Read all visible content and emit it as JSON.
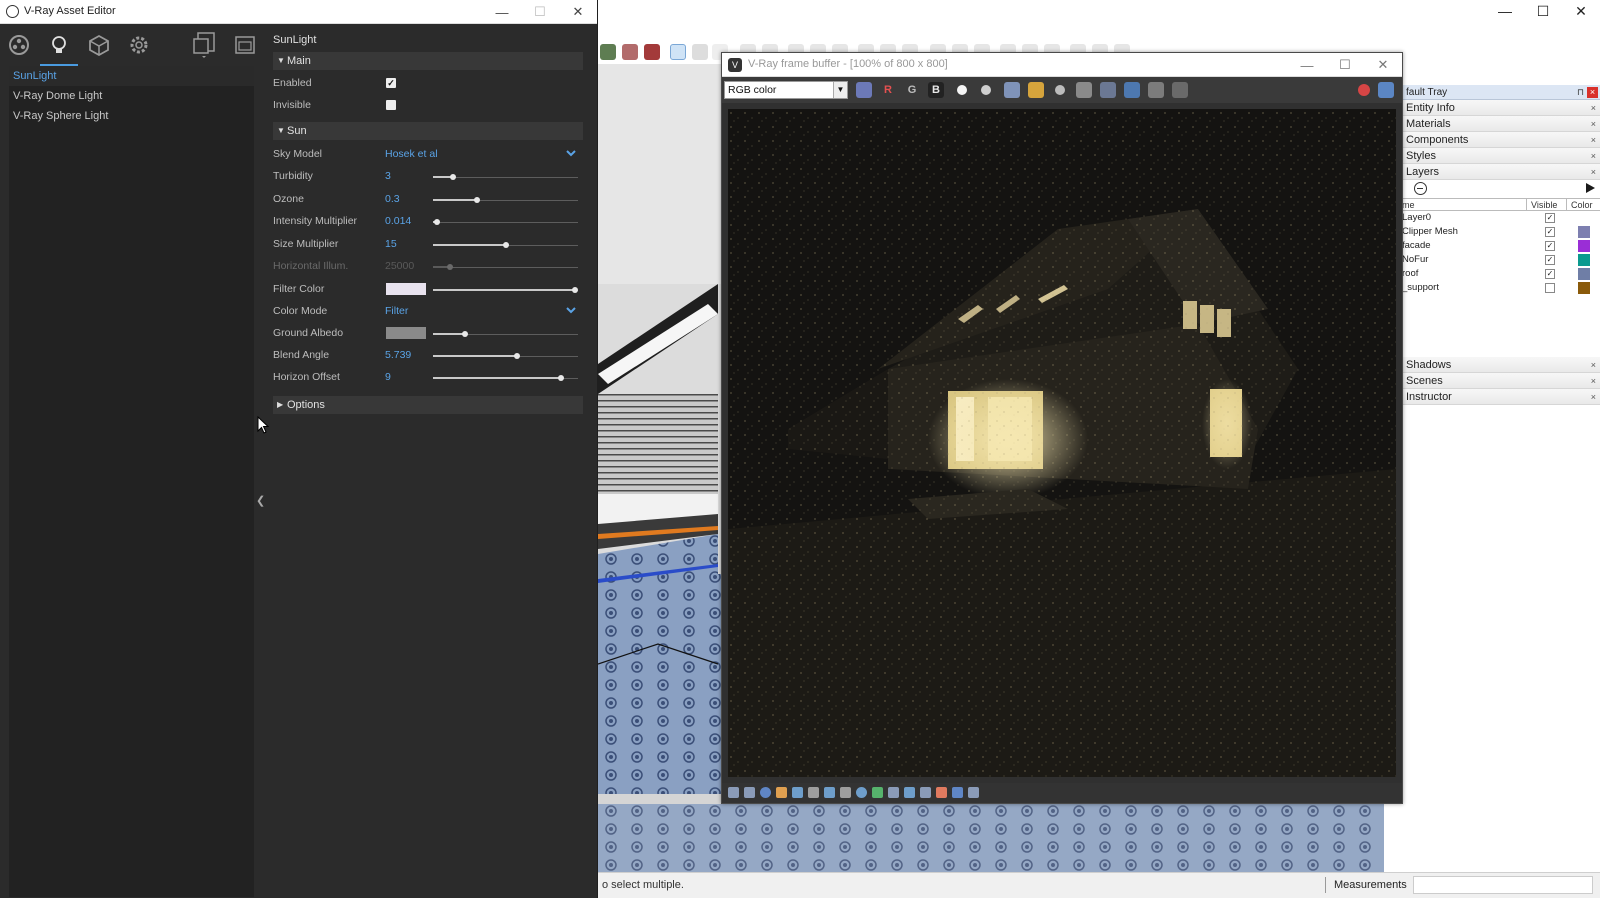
{
  "sketchup": {
    "status_text": "o select multiple.",
    "measurements_label": "Measurements",
    "window_controls": [
      "—",
      "☐",
      "✕"
    ]
  },
  "tray": {
    "title": "fault Tray",
    "pin": "⊓",
    "close": "×",
    "sections_top": [
      "Entity Info",
      "Materials",
      "Components",
      "Styles",
      "Layers"
    ],
    "layers_columns": {
      "name": "me",
      "visible": "Visible",
      "color": "Color"
    },
    "layers": [
      {
        "name": "Layer0",
        "visible": true,
        "color": ""
      },
      {
        "name": "Clipper Mesh",
        "visible": true,
        "color": "#7d7fb0"
      },
      {
        "name": "facade",
        "visible": true,
        "color": "#9a2ed6"
      },
      {
        "name": "NoFur",
        "visible": true,
        "color": "#0b9a8f"
      },
      {
        "name": "roof",
        "visible": true,
        "color": "#6f7ea6"
      },
      {
        "name": "_support",
        "visible": false,
        "color": "#8a5a0a"
      }
    ],
    "sections_bottom": [
      "Shadows",
      "Scenes",
      "Instructor"
    ],
    "section_close": "×"
  },
  "vfb": {
    "title": "V-Ray frame buffer - [100% of 800 x 800]",
    "channel": "RGB color",
    "channel_letters": [
      "R",
      "G",
      "B"
    ],
    "window_controls": [
      "—",
      "☐",
      "✕"
    ]
  },
  "asset_editor": {
    "title": "V-Ray Asset Editor",
    "window_controls": [
      "—",
      "☐",
      "✕"
    ],
    "light_list": [
      "SunLight",
      "V-Ray Dome Light",
      "V-Ray Sphere Light"
    ],
    "selected_light": "SunLight",
    "asset_name": "SunLight",
    "sections": {
      "main": "Main",
      "sun": "Sun",
      "options": "Options"
    },
    "main": {
      "enabled_label": "Enabled",
      "enabled": true,
      "invisible_label": "Invisible",
      "invisible": false
    },
    "sun": {
      "sky_model_label": "Sky Model",
      "sky_model": "Hosek et al",
      "turbidity_label": "Turbidity",
      "turbidity": "3",
      "turbidity_slider": 0.14,
      "ozone_label": "Ozone",
      "ozone": "0.3",
      "ozone_slider": 0.3,
      "intensity_label": "Intensity Multiplier",
      "intensity": "0.014",
      "intensity_slider": 0.03,
      "size_label": "Size Multiplier",
      "size": "15",
      "size_slider": 0.5,
      "horiz_label": "Horizontal Illum.",
      "horiz": "25000",
      "horiz_slider": 0.12,
      "filter_color_label": "Filter Color",
      "filter_color": "#e8e2ee",
      "filter_slider": 0.98,
      "color_mode_label": "Color Mode",
      "color_mode": "Filter",
      "ground_albedo_label": "Ground Albedo",
      "ground_albedo": "#8a8a8a",
      "ground_slider": 0.22,
      "blend_angle_label": "Blend Angle",
      "blend_angle": "5.739",
      "blend_slider": 0.58,
      "horizon_offset_label": "Horizon Offset",
      "horizon_offset": "9",
      "horizon_slider": 0.88
    }
  },
  "colors": {
    "accent": "#5aa3e6",
    "editor_bg": "#2b2b2b",
    "vfb_bg": "#303030"
  }
}
